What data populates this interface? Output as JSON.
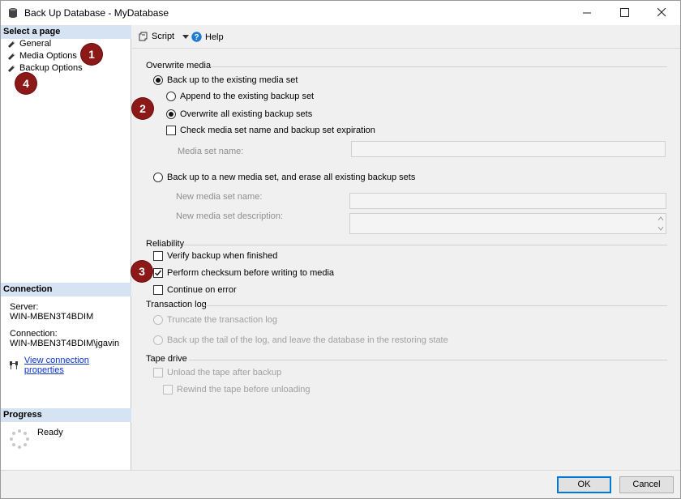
{
  "window": {
    "title": "Back Up Database - MyDatabase"
  },
  "left": {
    "select_page_header": "Select a page",
    "pages": [
      {
        "label": "General"
      },
      {
        "label": "Media Options"
      },
      {
        "label": "Backup Options"
      }
    ],
    "connection_header": "Connection",
    "server_label": "Server:",
    "server_value": "WIN-MBEN3T4BDIM",
    "connection_label": "Connection:",
    "connection_value": "WIN-MBEN3T4BDIM\\jgavin",
    "view_connection_link": "View connection properties",
    "progress_header": "Progress",
    "progress_status": "Ready"
  },
  "toolbar": {
    "script_label": "Script",
    "help_label": "Help"
  },
  "overwrite_media": {
    "group_label": "Overwrite media",
    "existing_media_set": {
      "label": "Back up to the existing media set",
      "selected": true
    },
    "append": {
      "label": "Append to the existing backup set",
      "selected": false
    },
    "overwrite_all": {
      "label": "Overwrite all existing backup sets",
      "selected": true
    },
    "check_media": {
      "label": "Check media set name and backup set expiration",
      "checked": false
    },
    "media_set_name_label": "Media set name:",
    "media_set_name_value": "",
    "new_media_set": {
      "label": "Back up to a new media set, and erase all existing backup sets",
      "selected": false
    },
    "new_media_set_name_label": "New media set name:",
    "new_media_set_name_value": "",
    "new_media_set_desc_label": "New media set description:",
    "new_media_set_desc_value": ""
  },
  "reliability": {
    "group_label": "Reliability",
    "verify": {
      "label": "Verify backup when finished",
      "checked": false
    },
    "checksum": {
      "label": "Perform checksum before writing to media",
      "checked": true
    },
    "continue_on_error": {
      "label": "Continue on error",
      "checked": false
    }
  },
  "transaction_log": {
    "group_label": "Transaction log",
    "truncate": {
      "label": "Truncate the transaction log"
    },
    "tail": {
      "label": "Back up the tail of the log, and leave the database in the restoring state"
    }
  },
  "tape_drive": {
    "group_label": "Tape drive",
    "unload": {
      "label": "Unload the tape after backup"
    },
    "rewind": {
      "label": "Rewind the tape before unloading"
    }
  },
  "callouts": [
    "1",
    "2",
    "3",
    "4"
  ],
  "buttons": {
    "ok": "OK",
    "cancel": "Cancel"
  },
  "colors": {
    "callout": "#8c1818",
    "header_bg": "#d5e3f2",
    "link": "#0b35c8",
    "accent": "#0078d7"
  },
  "icons": [
    "database-icon",
    "wrench-icon",
    "script-icon",
    "help-icon",
    "connection-icon",
    "spinner-icon",
    "minimize-icon",
    "maximize-icon",
    "close-icon"
  ]
}
